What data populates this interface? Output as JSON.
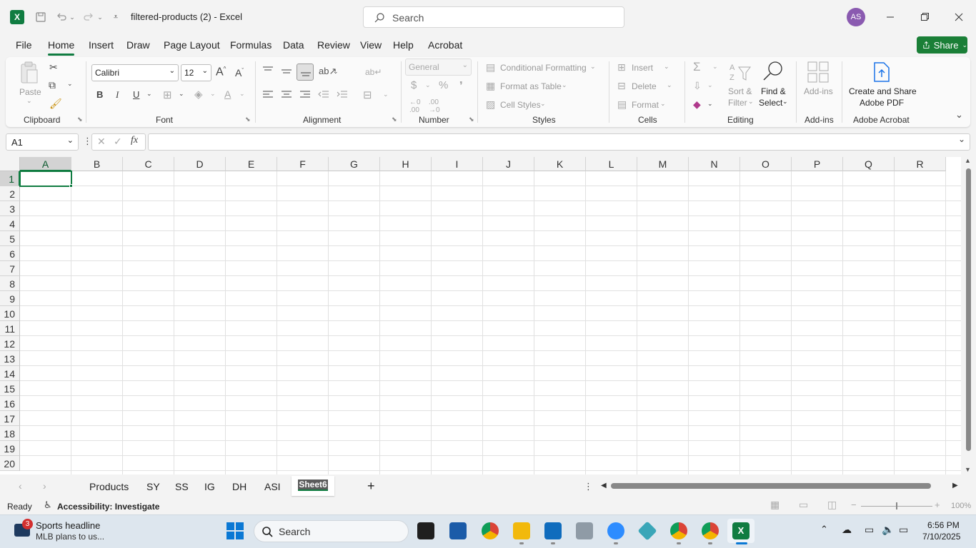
{
  "titlebar": {
    "app_icon": "X",
    "title": "filtered-products (2)  -  Excel",
    "search_placeholder": "Search",
    "avatar_initials": "AS"
  },
  "menu": {
    "file": "File",
    "home": "Home",
    "insert": "Insert",
    "draw": "Draw",
    "page_layout": "Page Layout",
    "formulas": "Formulas",
    "data": "Data",
    "review": "Review",
    "view": "View",
    "help": "Help",
    "acrobat": "Acrobat",
    "share": "Share"
  },
  "ribbon": {
    "clipboard": {
      "label": "Clipboard",
      "paste": "Paste"
    },
    "font": {
      "label": "Font",
      "name": "Calibri",
      "size": "12",
      "bold": "B",
      "italic": "I",
      "underline": "U"
    },
    "alignment": {
      "label": "Alignment"
    },
    "number": {
      "label": "Number",
      "format": "General"
    },
    "styles": {
      "label": "Styles",
      "conditional": "Conditional Formatting",
      "format_table": "Format as Table",
      "cell_styles": "Cell Styles"
    },
    "cells": {
      "label": "Cells",
      "insert": "Insert",
      "delete": "Delete",
      "format": "Format"
    },
    "editing": {
      "label": "Editing",
      "sort_filter_1": "Sort &",
      "sort_filter_2": "Filter",
      "find_select_1": "Find &",
      "find_select_2": "Select"
    },
    "addins": {
      "label": "Add-ins",
      "button": "Add-ins"
    },
    "acrobat": {
      "label": "Adobe Acrobat",
      "create_1": "Create and Share",
      "create_2": "Adobe PDF"
    }
  },
  "formula_bar": {
    "name_box": "A1",
    "fx": "fx",
    "value": ""
  },
  "grid": {
    "columns": [
      "A",
      "B",
      "C",
      "D",
      "E",
      "F",
      "G",
      "H",
      "I",
      "J",
      "K",
      "L",
      "M",
      "N",
      "O",
      "P",
      "Q",
      "R"
    ],
    "rows": [
      "1",
      "2",
      "3",
      "4",
      "5",
      "6",
      "7",
      "8",
      "9",
      "10",
      "11",
      "12",
      "13",
      "14",
      "15",
      "16",
      "17",
      "18",
      "19",
      "20"
    ],
    "selected_cell": "A1"
  },
  "sheets": {
    "tabs": [
      "Products",
      "SY",
      "SS",
      "IG",
      "DH",
      "ASI",
      "Sheet6"
    ],
    "active": "Sheet6",
    "add": "+"
  },
  "status": {
    "ready": "Ready",
    "accessibility": "Accessibility: Investigate",
    "zoom": "100%"
  },
  "taskbar": {
    "news_badge": "3",
    "news_title": "Sports headline",
    "news_sub": "MLB plans to us...",
    "search": "Search",
    "time": "6:56 PM",
    "date": "7/10/2025"
  },
  "colors": {
    "excel_green": "#107c41",
    "share_green": "#1a7f37"
  }
}
